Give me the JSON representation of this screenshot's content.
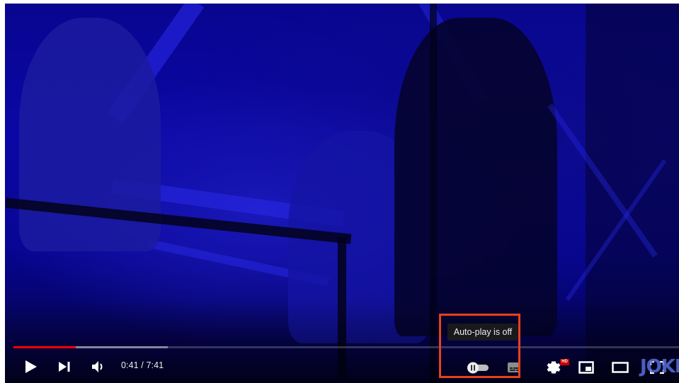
{
  "player": {
    "time": {
      "current": "0:41",
      "separator": " / ",
      "duration": "7:41"
    },
    "progress": {
      "played_fraction": 0.0934,
      "loaded_fraction": 0.2323
    },
    "tooltip": "Auto-play is off",
    "hd_badge": "HD",
    "watermark": "JOKER",
    "colors": {
      "progress_played": "#ff0000",
      "highlight_box": "#e8401c",
      "hd_badge": "#cc0000"
    },
    "controls": {
      "play": "play-icon",
      "next": "next-icon",
      "volume": "volume-icon",
      "autoplay": "autoplay-toggle-icon",
      "subtitles": "subtitles-icon",
      "settings": "gear-icon",
      "miniplayer": "miniplayer-icon",
      "theater": "theater-mode-icon",
      "fullscreen": "fullscreen-icon"
    }
  }
}
